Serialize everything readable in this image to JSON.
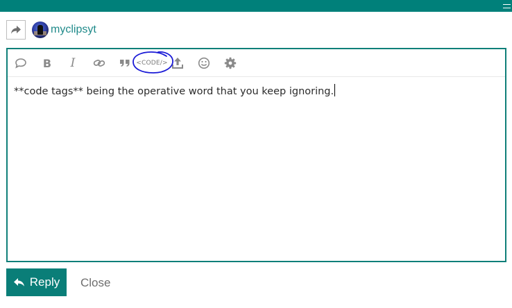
{
  "topbar": {
    "partial_text": "···················· ·· ·",
    "menu_icon": "hamburger-lines-icon"
  },
  "reply_to": {
    "share_icon": "share-arrow-icon",
    "username": "myclipsyt"
  },
  "toolbar": {
    "items": [
      {
        "name": "quote-bubble-icon"
      },
      {
        "name": "bold-icon",
        "label": "B"
      },
      {
        "name": "italic-icon",
        "label": "I"
      },
      {
        "name": "link-icon"
      },
      {
        "name": "blockquote-icon"
      },
      {
        "name": "code-icon",
        "label": "<CODE/>"
      },
      {
        "name": "upload-icon"
      },
      {
        "name": "emoji-icon"
      },
      {
        "name": "gear-icon"
      }
    ],
    "annotation": {
      "shape": "hand-drawn circle",
      "color": "#1a1ad6"
    }
  },
  "editor": {
    "text": "**code tags** being the operative word that you keep ignoring."
  },
  "actions": {
    "reply_label": "Reply",
    "close_label": "Close"
  },
  "colors": {
    "accent": "#0a7e78",
    "border": "#0f7f79",
    "username": "#1f8a8a",
    "annotation": "#1a1ad6"
  }
}
